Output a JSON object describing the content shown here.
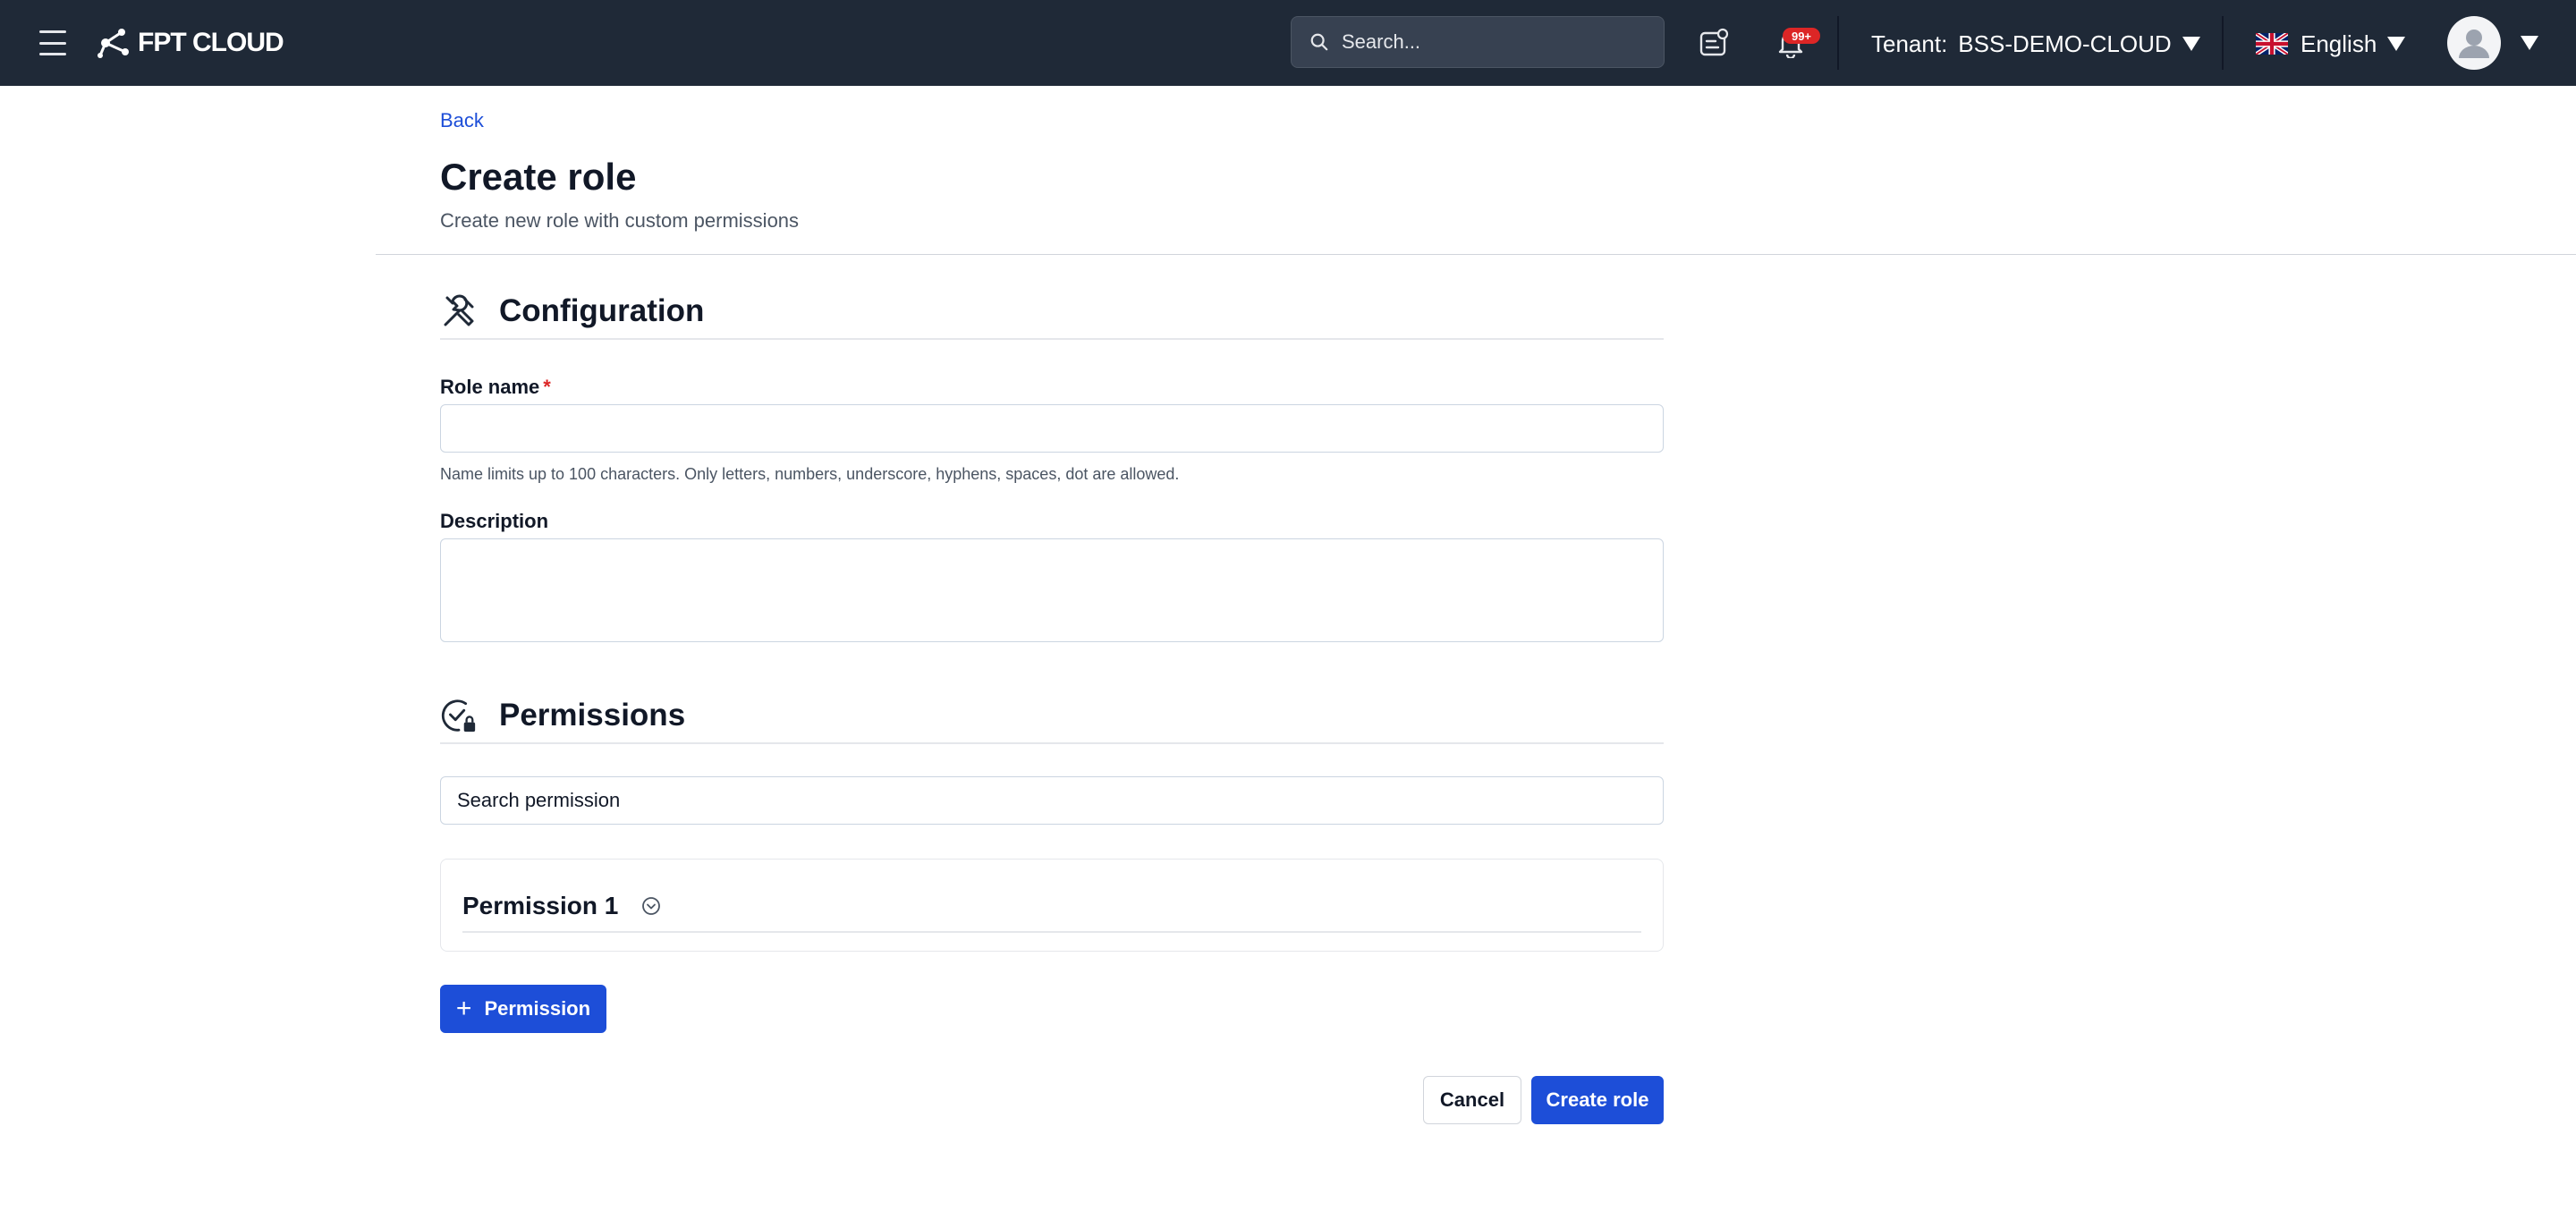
{
  "header": {
    "logo_text": "FPT CLOUD",
    "search_placeholder": "Search...",
    "notifications_badge": "99+",
    "tenant_label": "Tenant:",
    "tenant_value": "BSS-DEMO-CLOUD",
    "language": "English",
    "icons": [
      "menu-icon",
      "fpt-logo-icon",
      "search-icon",
      "support-ticket-icon",
      "bell-icon",
      "uk-flag-icon",
      "user-avatar-icon",
      "caret-down-icon"
    ],
    "colors": {
      "bar": "#1f2937",
      "badge": "#dc2626"
    }
  },
  "page": {
    "back_label": "Back",
    "title": "Create role",
    "subtitle": "Create new role with custom permissions"
  },
  "configuration": {
    "title": "Configuration",
    "icon": "tools-icon",
    "role_name_label": "Role name",
    "required_mark": "*",
    "role_name_value": "",
    "role_name_hint": "Name limits up to 100 characters. Only letters, numbers, underscore, hyphens, spaces, dot are allowed.",
    "description_label": "Description",
    "description_value": ""
  },
  "permissions": {
    "title": "Permissions",
    "icon": "badge-check-lock-icon",
    "search_placeholder": "Search permission",
    "items": [
      {
        "label": "Permission 1",
        "icon": "chevron-down-circle-icon"
      }
    ],
    "add_label": "Permission"
  },
  "actions": {
    "cancel_label": "Cancel",
    "submit_label": "Create role",
    "colors": {
      "primary": "#1d4ed8"
    }
  }
}
